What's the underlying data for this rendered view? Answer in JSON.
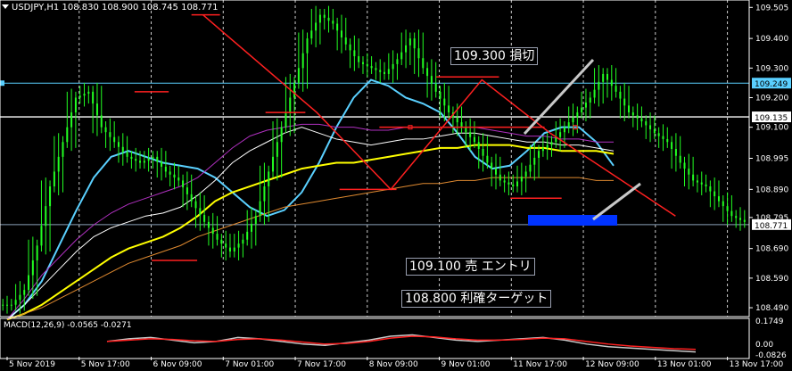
{
  "header": {
    "symbol_tf": "USDJPY,H1",
    "ohlc": "108.830 108.900 108.745 108.771"
  },
  "annotations": {
    "stop": "109.300 損切",
    "entry": "109.100 売 エントリ",
    "target": "108.800 利確ターゲット"
  },
  "macd": {
    "label": "MACD(12,26,9) -0.0565 -0.0271"
  },
  "colors": {
    "background": "#000000",
    "candle": "#22ff22",
    "ema_fast": "#5ad0ff",
    "ma_yellow": "#ffff00",
    "ma_magenta": "#b030c0",
    "ma_white": "#ffffff",
    "ma_orange": "#e08a30",
    "drawing": "#ff2020",
    "target_box": "#0033ff",
    "arrow": "#c8c8c8"
  },
  "chart_data": {
    "type": "candlestick",
    "x_ticks": [
      "5 Nov 2019",
      "5 Nov 17:00",
      "6 Nov 09:00",
      "7 Nov 01:00",
      "7 Nov 17:00",
      "8 Nov 09:00",
      "9 Nov 01:00",
      "11 Nov 17:00",
      "12 Nov 09:00",
      "13 Nov 01:00",
      "13 Nov 17:00"
    ],
    "y_ticks": [
      109.505,
      109.4,
      109.3,
      109.2,
      109.1,
      108.995,
      108.89,
      108.795,
      108.69,
      108.59,
      108.49
    ],
    "ylim": [
      108.46,
      109.53
    ],
    "price_labels": [
      {
        "value": 109.249,
        "text": "109.249",
        "style": "highlight"
      },
      {
        "value": 109.135,
        "text": "109.135",
        "style": "white-line"
      },
      {
        "value": 108.771,
        "text": "108.771",
        "style": "current"
      }
    ],
    "price_path": [
      108.5,
      108.55,
      108.7,
      108.9,
      109.05,
      109.2,
      109.22,
      109.1,
      109.05,
      109.0,
      108.98,
      109.0,
      108.95,
      108.92,
      108.85,
      108.78,
      108.72,
      108.68,
      108.72,
      108.8,
      108.95,
      109.1,
      109.25,
      109.4,
      109.48,
      109.45,
      109.38,
      109.32,
      109.3,
      109.28,
      109.33,
      109.4,
      109.3,
      109.22,
      109.15,
      109.1,
      109.05,
      108.98,
      108.92,
      108.9,
      108.95,
      109.02,
      109.05,
      109.1,
      109.15,
      109.2,
      109.28,
      109.22,
      109.15,
      109.12,
      109.08,
      109.05,
      108.98,
      108.92,
      108.9,
      108.85,
      108.8,
      108.78
    ],
    "x_index_ticks": [
      0,
      5.6,
      11.2,
      16.8,
      22.4,
      28,
      33.6,
      39.2,
      44.8,
      50.4,
      56
    ],
    "moving_averages": [
      {
        "color": "#5ad0ff",
        "values": [
          108.45,
          108.5,
          108.58,
          108.7,
          108.82,
          108.93,
          109.0,
          109.02,
          109.0,
          108.98,
          108.97,
          108.96,
          108.93,
          108.88,
          108.83,
          108.8,
          108.82,
          108.88,
          108.98,
          109.1,
          109.2,
          109.26,
          109.24,
          109.2,
          109.18,
          109.15,
          109.08,
          109.0,
          108.96,
          108.97,
          109.02,
          109.08,
          109.1,
          109.1,
          109.05,
          108.97
        ]
      },
      {
        "color": "#ffffff",
        "values": [
          108.45,
          108.5,
          108.56,
          108.62,
          108.68,
          108.73,
          108.76,
          108.78,
          108.8,
          108.81,
          108.83,
          108.87,
          108.92,
          108.98,
          109.02,
          109.05,
          109.08,
          109.1,
          109.08,
          109.06,
          109.05,
          109.04,
          109.05,
          109.06,
          109.06,
          109.07,
          109.08,
          109.08,
          109.07,
          109.06,
          109.05,
          109.05,
          109.04,
          109.04,
          109.03,
          109.02
        ]
      },
      {
        "color": "#b030c0",
        "values": [
          108.45,
          108.52,
          108.6,
          108.66,
          108.72,
          108.77,
          108.81,
          108.84,
          108.86,
          108.88,
          108.9,
          108.93,
          108.98,
          109.03,
          109.07,
          109.09,
          109.1,
          109.11,
          109.11,
          109.1,
          109.1,
          109.09,
          109.09,
          109.1,
          109.1,
          109.1,
          109.1,
          109.1,
          109.09,
          109.08,
          109.07,
          109.07,
          109.06,
          109.06,
          109.05,
          109.05
        ]
      },
      {
        "color": "#ffff00",
        "values": [
          108.45,
          108.47,
          108.5,
          108.54,
          108.58,
          108.62,
          108.66,
          108.69,
          108.71,
          108.73,
          108.76,
          108.8,
          108.85,
          108.88,
          108.9,
          108.92,
          108.94,
          108.96,
          108.97,
          108.98,
          108.98,
          108.99,
          109.0,
          109.01,
          109.02,
          109.03,
          109.03,
          109.04,
          109.04,
          109.04,
          109.03,
          109.03,
          109.02,
          109.02,
          109.02,
          109.01
        ]
      },
      {
        "color": "#e08a30",
        "values": [
          108.45,
          108.47,
          108.49,
          108.52,
          108.55,
          108.58,
          108.61,
          108.64,
          108.66,
          108.68,
          108.7,
          108.73,
          108.75,
          108.77,
          108.79,
          108.81,
          108.83,
          108.84,
          108.85,
          108.86,
          108.87,
          108.88,
          108.89,
          108.9,
          108.91,
          108.91,
          108.92,
          108.92,
          108.93,
          108.93,
          108.93,
          108.93,
          108.93,
          108.93,
          108.92,
          108.92
        ]
      }
    ],
    "drawings": {
      "zigzag": [
        [
          35,
          109.48
        ],
        [
          55,
          109.15
        ],
        [
          68,
          108.89
        ],
        [
          84,
          109.26
        ],
        [
          96,
          109.08
        ],
        [
          118,
          108.8
        ]
      ],
      "h_lines": [
        {
          "y": 109.22,
          "from": 23,
          "to": 29
        },
        {
          "y": 109.48,
          "from": 33,
          "to": 38
        },
        {
          "y": 109.15,
          "from": 46,
          "to": 53
        },
        {
          "y": 108.65,
          "from": 26,
          "to": 34
        },
        {
          "y": 108.89,
          "from": 59,
          "to": 69
        },
        {
          "y": 109.27,
          "from": 76,
          "to": 87
        },
        {
          "y": 109.1,
          "from": 66,
          "to": 95
        },
        {
          "y": 108.86,
          "from": 89,
          "to": 98
        }
      ]
    },
    "macd_ylim": [
      -0.0826,
      0.1749
    ],
    "macd_ticks": [
      0.1749,
      0.0,
      -0.0826
    ],
    "macd_series": [
      {
        "color": "#c8c8c8",
        "values": [
          0.02,
          0.04,
          0.05,
          0.03,
          0.01,
          0.02,
          0.05,
          0.04,
          0.02,
          0.0,
          -0.01,
          0.01,
          0.03,
          0.06,
          0.07,
          0.05,
          0.03,
          0.02,
          0.03,
          0.04,
          0.05,
          0.03,
          0.0,
          -0.02,
          -0.03,
          -0.04,
          -0.05,
          -0.06
        ]
      },
      {
        "color": "#ff2020",
        "values": [
          0.02,
          0.03,
          0.04,
          0.035,
          0.025,
          0.02,
          0.035,
          0.04,
          0.03,
          0.015,
          0.0,
          0.005,
          0.02,
          0.045,
          0.06,
          0.055,
          0.04,
          0.03,
          0.03,
          0.035,
          0.045,
          0.04,
          0.02,
          0.0,
          -0.015,
          -0.025,
          -0.035,
          -0.04
        ]
      }
    ]
  }
}
